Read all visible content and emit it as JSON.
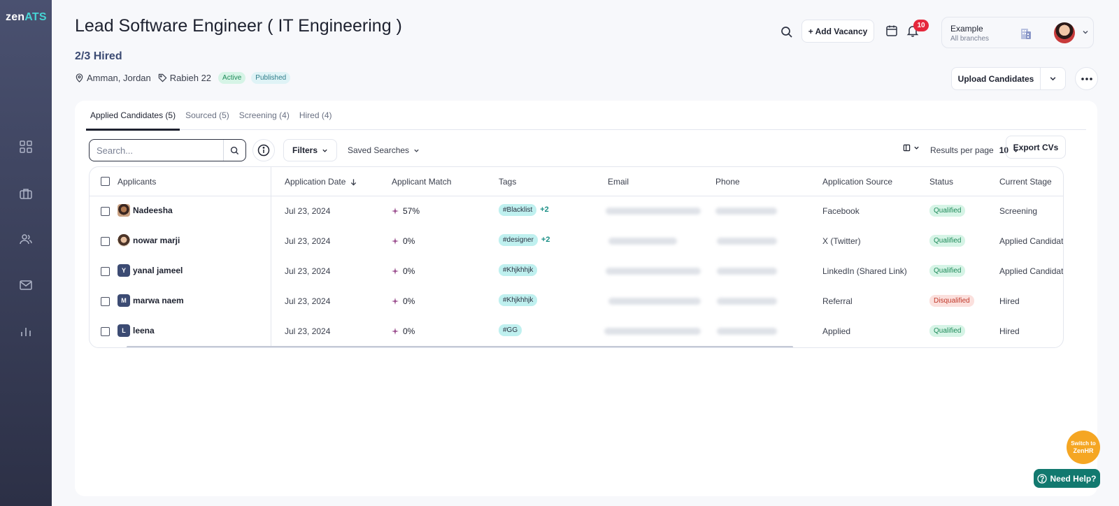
{
  "brand": {
    "logo_main": "zen",
    "logo_accent": "ATS"
  },
  "sidebar": {
    "items": [
      {
        "icon": "dashboard-icon"
      },
      {
        "icon": "briefcase-icon"
      },
      {
        "icon": "users-icon"
      },
      {
        "icon": "mail-icon"
      },
      {
        "icon": "bar-chart-icon"
      }
    ]
  },
  "header": {
    "title": "Lead Software Engineer ( IT Engineering )",
    "hired_count": "2/3 Hired",
    "location": "Amman, Jordan",
    "owner": "Rabieh 22",
    "status_chip": "Active",
    "publish_chip": "Published",
    "add_vacancy_label": "+ Add Vacancy",
    "notification_count": "10",
    "account_name": "Example",
    "account_branch": "All branches",
    "upload_label": "Upload Candidates"
  },
  "tabs": [
    {
      "label": "Applied Candidates (5)",
      "selected": true
    },
    {
      "label": "Sourced (5)",
      "selected": false
    },
    {
      "label": "Screening (4)",
      "selected": false
    },
    {
      "label": "Hired (4)",
      "selected": false
    }
  ],
  "toolbar": {
    "search_placeholder": "Search...",
    "filters_label": "Filters",
    "saved_searches_label": "Saved Searches",
    "results_per_page_label": "Results per page",
    "results_per_page_value": "10",
    "export_label": "Export CVs"
  },
  "table": {
    "columns": {
      "applicants": "Applicants",
      "application_date": "Application Date",
      "applicant_match": "Applicant Match",
      "tags": "Tags",
      "email": "Email",
      "phone": "Phone",
      "application_source": "Application Source",
      "status": "Status",
      "current_stage": "Current Stage"
    },
    "rows": [
      {
        "name": "Nadeesha",
        "avatar": "photo1",
        "initial": "",
        "date": "Jul 23, 2024",
        "match": "57%",
        "tag": "#Blacklist",
        "tag_more": "+2",
        "source": "Facebook",
        "status": "Qualified",
        "stage": "Screening"
      },
      {
        "name": "nowar marji",
        "avatar": "photo2",
        "initial": "",
        "date": "Jul 23, 2024",
        "match": "0%",
        "tag": "#designer",
        "tag_more": "+2",
        "source": "X (Twitter)",
        "status": "Qualified",
        "stage": "Applied Candidate"
      },
      {
        "name": "yanal jameel",
        "avatar": "initial",
        "initial": "Y",
        "date": "Jul 23, 2024",
        "match": "0%",
        "tag": "#Khjkhhjk",
        "tag_more": "",
        "source": "LinkedIn (Shared Link)",
        "status": "Qualified",
        "stage": "Applied Candidate"
      },
      {
        "name": "marwa naem",
        "avatar": "initial",
        "initial": "M",
        "date": "Jul 23, 2024",
        "match": "0%",
        "tag": "#Khjkhhjk",
        "tag_more": "",
        "source": "Referral",
        "status": "Disqualified",
        "stage": "Hired"
      },
      {
        "name": "leena",
        "avatar": "initial",
        "initial": "L",
        "date": "Jul 23, 2024",
        "match": "0%",
        "tag": "#GG",
        "tag_more": "",
        "source": "Applied",
        "status": "Qualified",
        "stage": "Hired"
      }
    ]
  },
  "widgets": {
    "switch_line1": "Switch to",
    "switch_line2": "ZenHR",
    "need_help_label": "Need Help?"
  },
  "colors": {
    "sidebar_top": "#4a5170",
    "sidebar_bottom": "#2c3046",
    "accent_teal": "#46d4d4",
    "qualified": "#1f8a5a",
    "disqualified": "#c0392b",
    "need_help": "#12796f",
    "switch_orange": "#f5a623",
    "notification": "#e5283c"
  }
}
